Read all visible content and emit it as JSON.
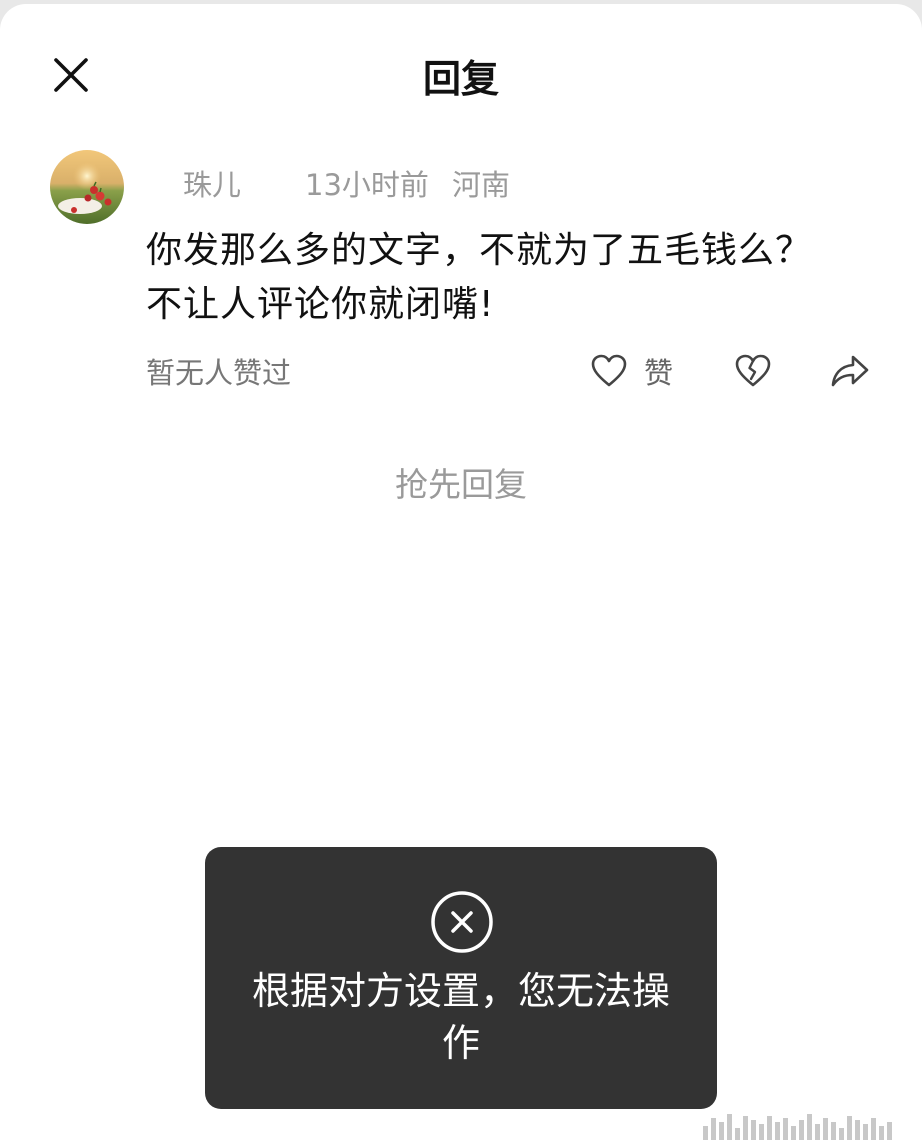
{
  "header": {
    "title": "回复",
    "close_icon": "close-icon"
  },
  "comment": {
    "avatar_icon": "avatar",
    "username": "珠儿",
    "time": "13小时前",
    "location": "河南",
    "text": "你发那么多的文字，不就为了五毛钱么？不让人评论你就闭嘴!",
    "likes_status": "暂无人赞过",
    "like_label": "赞",
    "like_icon": "heart-icon",
    "dislike_icon": "broken-heart-icon",
    "share_icon": "share-arrow-icon"
  },
  "reply_prompt": "抢先回复",
  "toast": {
    "icon": "error-circle-icon",
    "message": "根据对方设置，您无法操作"
  },
  "colors": {
    "background": "#ffffff",
    "text_primary": "#111111",
    "text_secondary": "#9a9a9a",
    "toast_bg": "#333333",
    "toast_text": "#ffffff"
  }
}
